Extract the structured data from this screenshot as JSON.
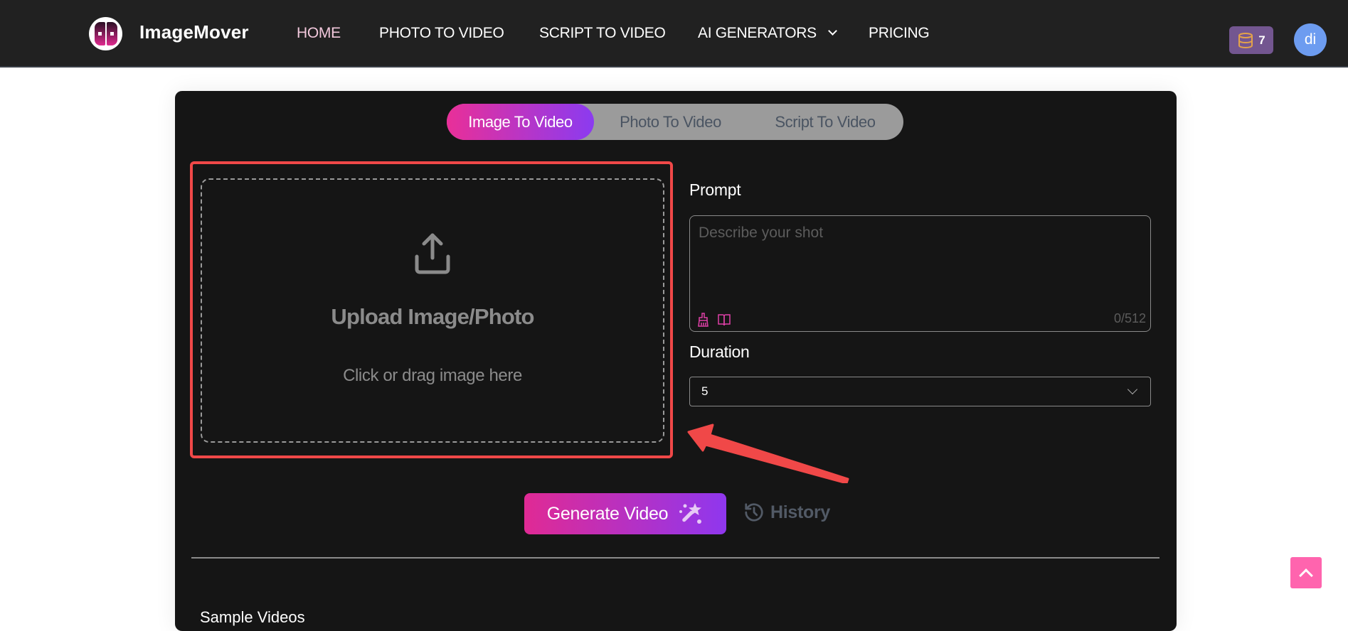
{
  "app": {
    "name": "ImageMover"
  },
  "nav": {
    "items": [
      {
        "label": "HOME",
        "active": true
      },
      {
        "label": "PHOTO TO VIDEO",
        "active": false
      },
      {
        "label": "SCRIPT TO VIDEO",
        "active": false
      },
      {
        "label": "AI GENERATORS",
        "active": false,
        "has_dropdown": true
      },
      {
        "label": "PRICING",
        "active": false
      }
    ],
    "credits": "7",
    "credits_icon": "coins-stack-icon",
    "avatar_initials": "di"
  },
  "mode_tabs": [
    {
      "label": "Image To Video",
      "active": true
    },
    {
      "label": "Photo To Video",
      "active": false
    },
    {
      "label": "Script To Video",
      "active": false
    }
  ],
  "upload": {
    "icon": "upload-icon",
    "title": "Upload Image/Photo",
    "subtitle": "Click or drag image here"
  },
  "prompt": {
    "label": "Prompt",
    "placeholder": "Describe your shot",
    "value": "",
    "counter": "0/512",
    "tools": [
      "clear-brush-icon",
      "prompt-library-book-icon"
    ]
  },
  "duration": {
    "label": "Duration",
    "selected": "5"
  },
  "actions": {
    "generate_label": "Generate Video",
    "history_label": "History"
  },
  "sections": {
    "sample_title": "Sample Videos"
  },
  "colors": {
    "accent_pink": "#e92f98",
    "accent_purple": "#8b3bf0",
    "highlight_red": "#f04848",
    "credits_bg": "#735690",
    "avatar_bg": "#6d9cf0",
    "scroll_top_bg": "#ff64ae"
  }
}
